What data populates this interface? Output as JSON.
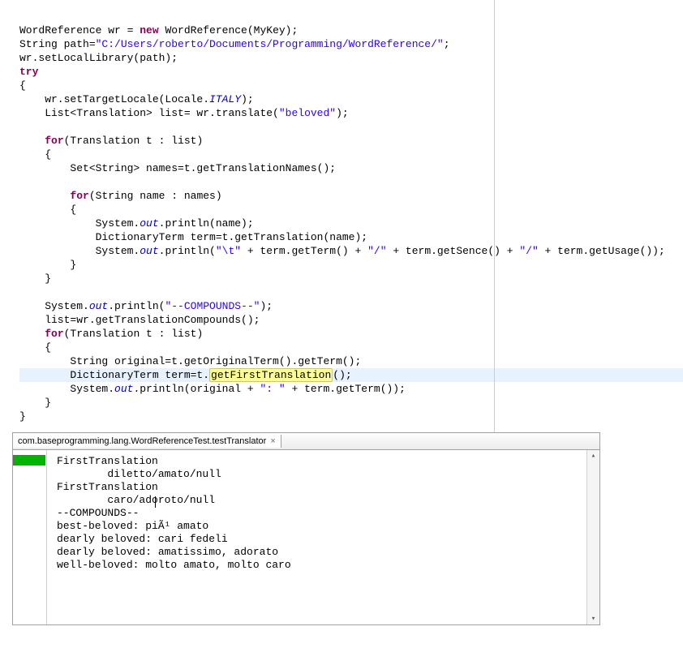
{
  "code": {
    "l1_a": "WordReference wr = ",
    "l1_new": "new",
    "l1_b": " WordReference(MyKey);",
    "l2_a": "String path=",
    "l2_str": "\"C:/Users/roberto/Documents/Programming/WordReference/\"",
    "l2_b": ";",
    "l3": "wr.setLocalLibrary(path);",
    "l4": "try",
    "l5": "{",
    "l6_a": "    wr.setTargetLocale(Locale.",
    "l6_it": "ITALY",
    "l6_b": ");",
    "l7_a": "    List<Translation> list= wr.translate(",
    "l7_str": "\"beloved\"",
    "l7_b": ");",
    "l9_for": "for",
    "l9_b": "(Translation t : list)",
    "l10": "    {",
    "l11": "        Set<String> names=t.getTranslationNames();",
    "l13_for": "for",
    "l13_b": "(String name : names)",
    "l14": "        {",
    "l15_a": "            System.",
    "l15_out": "out",
    "l15_b": ".println(name);",
    "l16": "            DictionaryTerm term=t.getTranslation(name);",
    "l17_a": "            System.",
    "l17_out": "out",
    "l17_b": ".println(",
    "l17_s1": "\"\\t\"",
    "l17_c": " + term.getTerm() + ",
    "l17_s2": "\"/\"",
    "l17_d": " + term.getSence() + ",
    "l17_s3": "\"/\"",
    "l17_e": " + term.getUsage());",
    "l18": "        }",
    "l19": "    }",
    "l21_a": "    System.",
    "l21_out": "out",
    "l21_b": ".println(",
    "l21_s": "\"--COMPOUNDS--\"",
    "l21_c": ");",
    "l22": "    list=wr.getTranslationCompounds();",
    "l23_for": "for",
    "l23_b": "(Translation t : list)",
    "l24": "    {",
    "l25": "        String original=t.getOriginalTerm().getTerm();",
    "l26_a": "        DictionaryTerm term=t.",
    "l26_hl": "getFirstTranslation",
    "l26_b": "();",
    "l27_a": "        System.",
    "l27_out": "out",
    "l27_b": ".println(original + ",
    "l27_s": "\": \"",
    "l27_c": " + term.getTerm());",
    "l28": "    }",
    "l29": "}"
  },
  "console": {
    "tab_label": "com.baseprogramming.lang.WordReferenceTest.testTranslator",
    "tab_close": "×",
    "lines": [
      "FirstTranslation",
      "        diletto/amato/null",
      "FirstTranslation",
      "        caro/adoroto/null",
      "--COMPOUNDS--",
      "best-beloved: piÃ¹ amato",
      "dearly beloved: cari fedeli",
      "dearly beloved: amatissimo, adorato",
      "well-beloved: molto amato, molto caro"
    ],
    "scroll_up": "▴",
    "scroll_down": "▾"
  }
}
